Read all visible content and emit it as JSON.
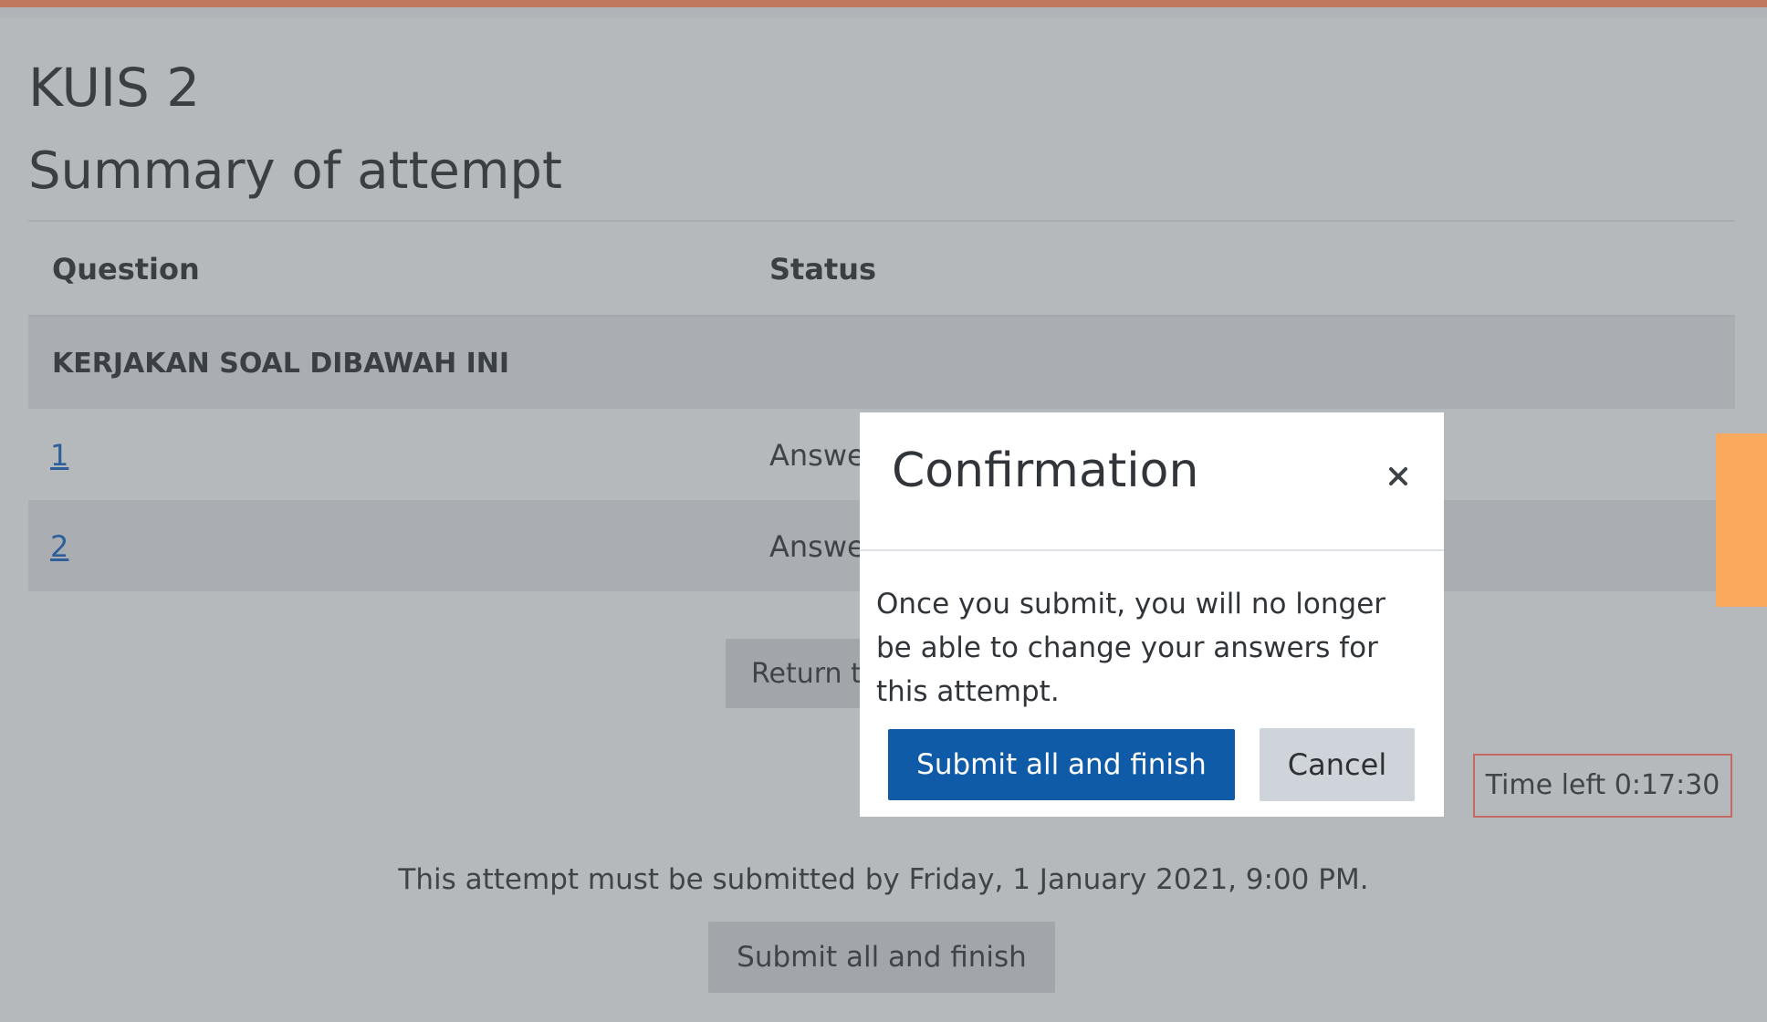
{
  "quiz": {
    "title": "KUIS 2",
    "subtitle": "Summary of attempt"
  },
  "summary_table": {
    "headers": [
      "Question",
      "Status"
    ],
    "section_label": "KERJAKAN SOAL DIBAWAH INI",
    "rows": [
      {
        "question": "1",
        "status": "Answe"
      },
      {
        "question": "2",
        "status": "Answe"
      }
    ]
  },
  "actions": {
    "return_label": "Return t",
    "deadline_text": "This attempt must be submitted by Friday, 1 January 2021, 9:00 PM.",
    "submit_label": "Submit all and finish"
  },
  "timer": {
    "text": "Time left 0:17:30"
  },
  "modal": {
    "title": "Confirmation",
    "close_glyph": "×",
    "body": "Once you submit, you will no longer be able to change your answers for this attempt.",
    "submit_label": "Submit all and finish",
    "cancel_label": "Cancel"
  },
  "colors": {
    "top_accent": "#c0795e",
    "primary_button": "#0f5ba8",
    "side_tab": "#fba95c",
    "timer_border": "#c26a63",
    "link": "#2f5f9a"
  },
  "icons": {
    "close": "close-icon"
  }
}
